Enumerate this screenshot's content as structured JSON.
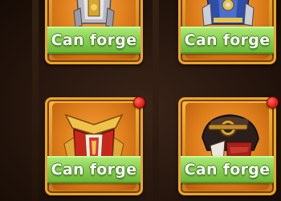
{
  "cards": [
    {
      "label": "Can forge",
      "item": "knight-armor-icon",
      "has_notification": false
    },
    {
      "label": "Can forge",
      "item": "blue-gold-armor-icon",
      "has_notification": false
    },
    {
      "label": "Can forge",
      "item": "red-gold-breastplate-icon",
      "has_notification": true
    },
    {
      "label": "Can forge",
      "item": "black-leather-helmet-icon",
      "has_notification": true
    }
  ],
  "colors": {
    "card_orange": "#e0901c",
    "card_border": "#e9a62a",
    "forge_green": "#86cf4f",
    "notification_red": "#e0201a",
    "background": "#26160d"
  }
}
